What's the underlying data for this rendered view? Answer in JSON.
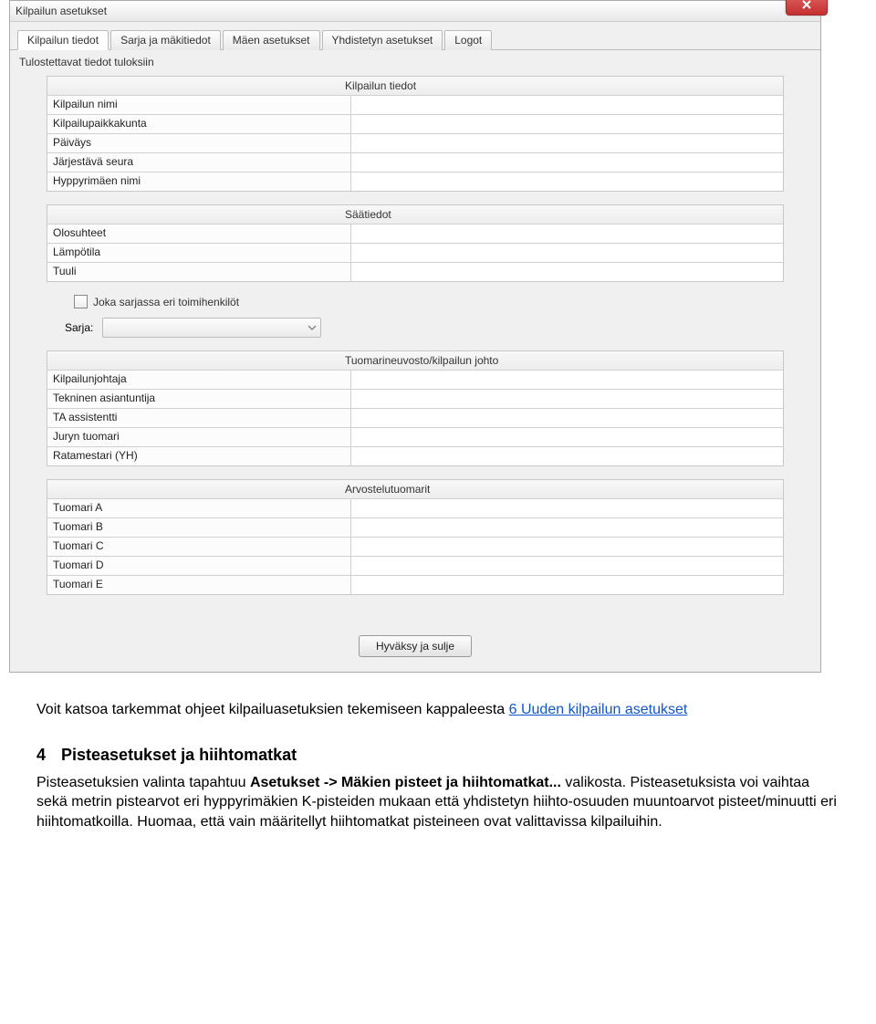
{
  "window": {
    "title": "Kilpailun asetukset"
  },
  "tabs": [
    {
      "label": "Kilpailun tiedot",
      "active": true
    },
    {
      "label": "Sarja ja mäkitiedot"
    },
    {
      "label": "Mäen asetukset"
    },
    {
      "label": "Yhdistetyn asetukset"
    },
    {
      "label": "Logot"
    }
  ],
  "sectionLabel": "Tulostettavat tiedot tuloksiin",
  "panels": {
    "kilpailu": {
      "headerLabel": "",
      "headerValue": "Kilpailun tiedot",
      "rows": [
        {
          "label": "Kilpailun nimi",
          "value": ""
        },
        {
          "label": "Kilpailupaikkakunta",
          "value": ""
        },
        {
          "label": "Päiväys",
          "value": ""
        },
        {
          "label": "Järjestävä seura",
          "value": ""
        },
        {
          "label": "Hyppyrimäen nimi",
          "value": ""
        }
      ]
    },
    "saa": {
      "headerLabel": "",
      "headerValue": "Säätiedot",
      "rows": [
        {
          "label": "Olosuhteet",
          "value": ""
        },
        {
          "label": "Lämpötila",
          "value": ""
        },
        {
          "label": "Tuuli",
          "value": ""
        }
      ]
    },
    "tuomari": {
      "headerLabel": "",
      "headerValue": "Tuomarineuvosto/kilpailun johto",
      "rows": [
        {
          "label": "Kilpailunjohtaja",
          "value": ""
        },
        {
          "label": "Tekninen asiantuntija",
          "value": ""
        },
        {
          "label": "TA assistentti",
          "value": ""
        },
        {
          "label": "Juryn tuomari",
          "value": ""
        },
        {
          "label": "Ratamestari (YH)",
          "value": ""
        }
      ]
    },
    "arvostelu": {
      "headerLabel": "",
      "headerValue": "Arvostelutuomarit",
      "rows": [
        {
          "label": "Tuomari A",
          "value": ""
        },
        {
          "label": "Tuomari B",
          "value": ""
        },
        {
          "label": "Tuomari C",
          "value": ""
        },
        {
          "label": "Tuomari D",
          "value": ""
        },
        {
          "label": "Tuomari E",
          "value": ""
        }
      ]
    }
  },
  "checkboxLabel": "Joka sarjassa eri toimihenkilöt",
  "sarjaLabel": "Sarja:",
  "approveButton": "Hyväksy ja sulje",
  "doc": {
    "p1a": "Voit katsoa tarkemmat ohjeet kilpailuasetuksien tekemiseen kappaleesta ",
    "p1link": "6  Uuden kilpailun asetukset",
    "hNum": "4",
    "hTitle": "Pisteasetukset ja hiihtomatkat",
    "p2a": "Pisteasetuksien valinta tapahtuu ",
    "p2b": "Asetukset -> Mäkien pisteet ja hiihtomatkat...",
    "p2c": " valikosta. Pisteasetuksista voi vaihtaa sekä metrin pistearvot eri hyppyrimäkien K-pisteiden mukaan että yhdistetyn hiihto-osuuden muuntoarvot pisteet/minuutti eri hiihtomatkoilla. Huomaa, että vain määritellyt hiihtomatkat pisteineen ovat valittavissa kilpailuihin."
  }
}
